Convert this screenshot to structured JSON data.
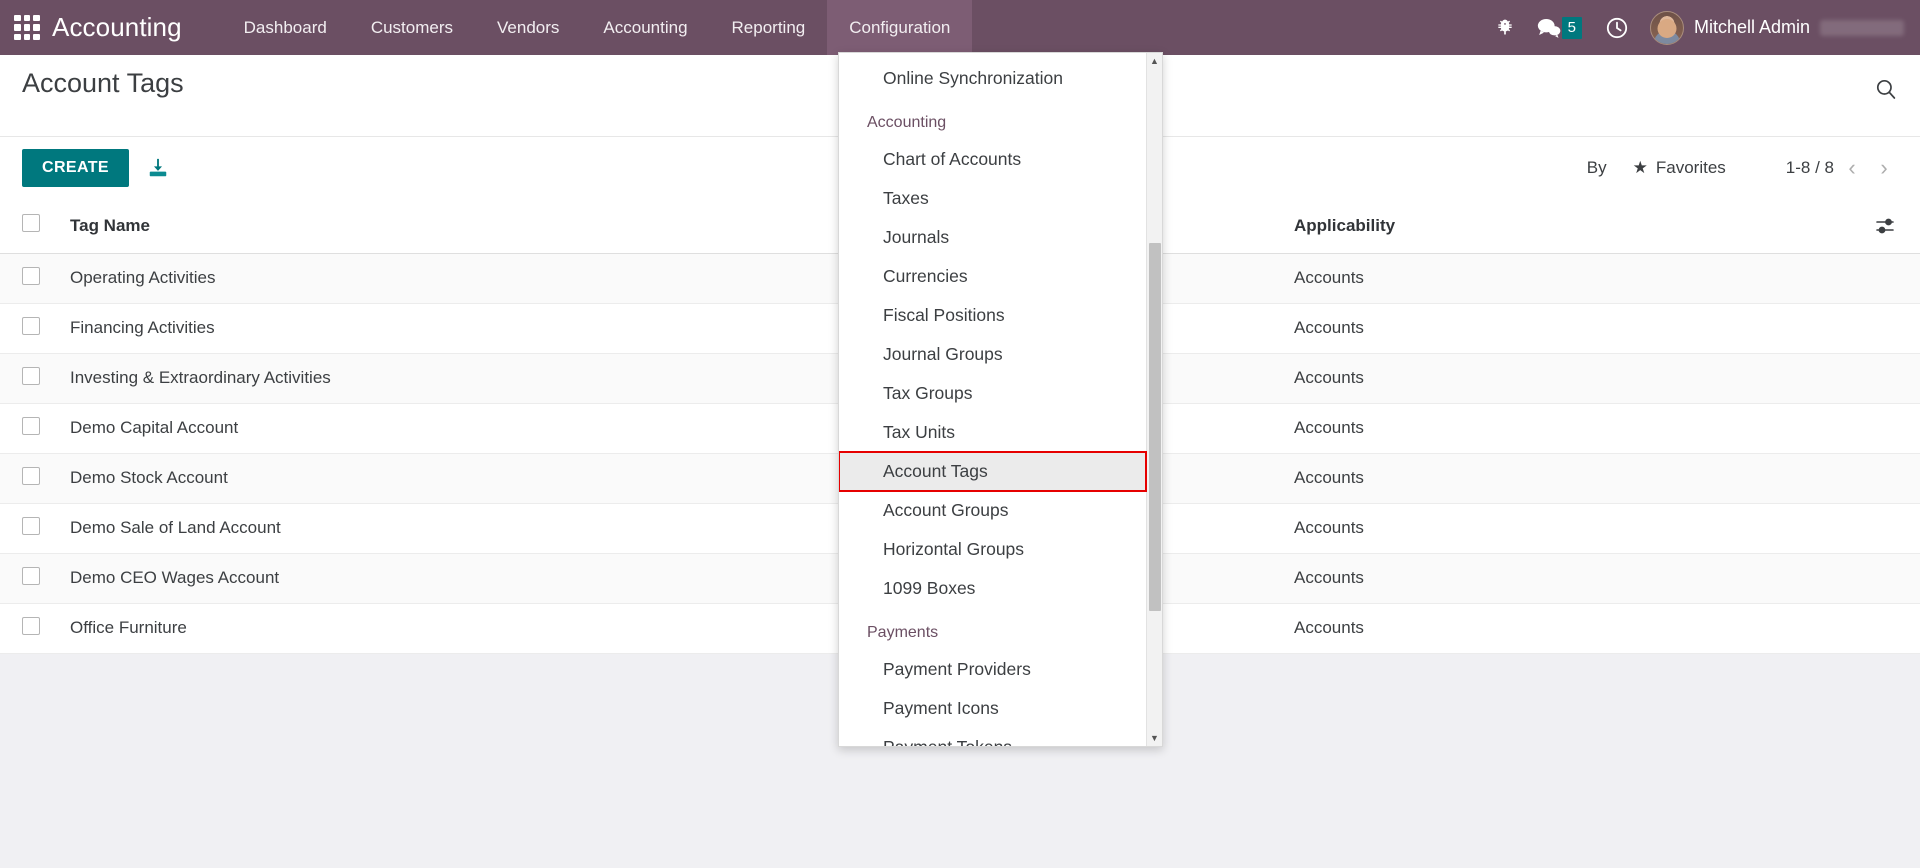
{
  "navbar": {
    "apps_icon": "apps-grid-icon",
    "brand": "Accounting",
    "menu": [
      {
        "label": "Dashboard",
        "active": false
      },
      {
        "label": "Customers",
        "active": false
      },
      {
        "label": "Vendors",
        "active": false
      },
      {
        "label": "Accounting",
        "active": false
      },
      {
        "label": "Reporting",
        "active": false
      },
      {
        "label": "Configuration",
        "active": true
      }
    ],
    "right": {
      "bug_icon": "bug-icon",
      "messages_icon": "messages-icon",
      "messages_count": "5",
      "activities_icon": "clock-icon",
      "avatar": "user-avatar",
      "username": "Mitchell Admin"
    }
  },
  "control_panel": {
    "title": "Account Tags",
    "create_label": "CREATE",
    "import_icon": "import-icon",
    "search_placeholder": "",
    "search_value": "",
    "search_icon": "search-icon",
    "filters": [
      {
        "label": "By",
        "icon": ""
      },
      {
        "label": "Favorites",
        "icon": "star-icon"
      }
    ],
    "pager": {
      "range": "1-8 / 8",
      "prev_icon": "chevron-left-icon",
      "next_icon": "chevron-right-icon"
    }
  },
  "list": {
    "columns": [
      "Tag Name",
      "Applicability"
    ],
    "options_icon": "column-settings-icon",
    "header_checkbox": "select-all-checkbox",
    "rows": [
      {
        "tag_name": "Operating Activities",
        "applicability": "Accounts"
      },
      {
        "tag_name": "Financing Activities",
        "applicability": "Accounts"
      },
      {
        "tag_name": "Investing & Extraordinary Activities",
        "applicability": "Accounts"
      },
      {
        "tag_name": "Demo Capital Account",
        "applicability": "Accounts"
      },
      {
        "tag_name": "Demo Stock Account",
        "applicability": "Accounts"
      },
      {
        "tag_name": "Demo Sale of Land Account",
        "applicability": "Accounts"
      },
      {
        "tag_name": "Demo CEO Wages Account",
        "applicability": "Accounts"
      },
      {
        "tag_name": "Office Furniture",
        "applicability": "Accounts"
      }
    ]
  },
  "dropdown": {
    "open_for": "Configuration",
    "scroll_up_icon": "scroll-up-arrow-icon",
    "scroll_down_icon": "scroll-down-arrow-icon",
    "entries": [
      {
        "type": "item",
        "label": "Online Synchronization",
        "highlighted": false
      },
      {
        "type": "section",
        "label": "Accounting"
      },
      {
        "type": "item",
        "label": "Chart of Accounts",
        "highlighted": false
      },
      {
        "type": "item",
        "label": "Taxes",
        "highlighted": false
      },
      {
        "type": "item",
        "label": "Journals",
        "highlighted": false
      },
      {
        "type": "item",
        "label": "Currencies",
        "highlighted": false
      },
      {
        "type": "item",
        "label": "Fiscal Positions",
        "highlighted": false
      },
      {
        "type": "item",
        "label": "Journal Groups",
        "highlighted": false
      },
      {
        "type": "item",
        "label": "Tax Groups",
        "highlighted": false
      },
      {
        "type": "item",
        "label": "Tax Units",
        "highlighted": false
      },
      {
        "type": "item",
        "label": "Account Tags",
        "highlighted": true
      },
      {
        "type": "item",
        "label": "Account Groups",
        "highlighted": false
      },
      {
        "type": "item",
        "label": "Horizontal Groups",
        "highlighted": false
      },
      {
        "type": "item",
        "label": "1099 Boxes",
        "highlighted": false
      },
      {
        "type": "section",
        "label": "Payments"
      },
      {
        "type": "item",
        "label": "Payment Providers",
        "highlighted": false
      },
      {
        "type": "item",
        "label": "Payment Icons",
        "highlighted": false
      },
      {
        "type": "item",
        "label": "Payment Tokens",
        "highlighted": false
      }
    ]
  },
  "colors": {
    "navbar": "#6b4f63",
    "navbar_active": "#7d5d74",
    "accent_teal": "#00787e",
    "highlight_outline": "#e60000",
    "page_bg": "#f0f0f3"
  }
}
